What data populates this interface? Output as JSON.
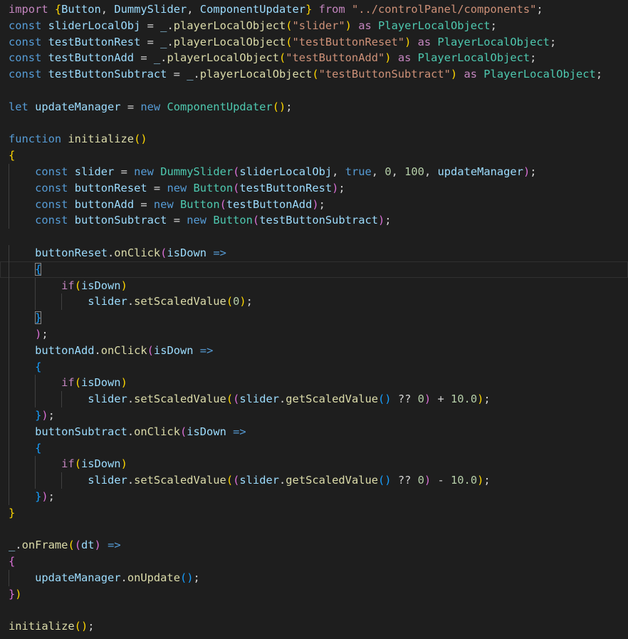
{
  "editor": {
    "language": "typescript",
    "theme": "dark",
    "lines": [
      [
        [
          "import ",
          "ctrl"
        ],
        [
          "{",
          "b1"
        ],
        [
          "Button",
          "var"
        ],
        [
          ", ",
          "op"
        ],
        [
          "DummySlider",
          "var"
        ],
        [
          ", ",
          "op"
        ],
        [
          "ComponentUpdater",
          "var"
        ],
        [
          "}",
          "b1"
        ],
        [
          " from ",
          "ctrl"
        ],
        [
          "\"../controlPanel/components\"",
          "str"
        ],
        [
          ";",
          "op"
        ]
      ],
      [
        [
          "const ",
          "kw"
        ],
        [
          "sliderLocalObj",
          "var"
        ],
        [
          " = ",
          "op"
        ],
        [
          "_",
          "var"
        ],
        [
          ".",
          "op"
        ],
        [
          "playerLocalObject",
          "fn"
        ],
        [
          "(",
          "b1"
        ],
        [
          "\"slider\"",
          "str"
        ],
        [
          ")",
          "b1"
        ],
        [
          " as ",
          "ctrl"
        ],
        [
          "PlayerLocalObject",
          "cls"
        ],
        [
          ";",
          "op"
        ]
      ],
      [
        [
          "const ",
          "kw"
        ],
        [
          "testButtonRest",
          "var"
        ],
        [
          " = ",
          "op"
        ],
        [
          "_",
          "var"
        ],
        [
          ".",
          "op"
        ],
        [
          "playerLocalObject",
          "fn"
        ],
        [
          "(",
          "b1"
        ],
        [
          "\"testButtonReset\"",
          "str"
        ],
        [
          ")",
          "b1"
        ],
        [
          " as ",
          "ctrl"
        ],
        [
          "PlayerLocalObject",
          "cls"
        ],
        [
          ";",
          "op"
        ]
      ],
      [
        [
          "const ",
          "kw"
        ],
        [
          "testButtonAdd",
          "var"
        ],
        [
          " = ",
          "op"
        ],
        [
          "_",
          "var"
        ],
        [
          ".",
          "op"
        ],
        [
          "playerLocalObject",
          "fn"
        ],
        [
          "(",
          "b1"
        ],
        [
          "\"testButtonAdd\"",
          "str"
        ],
        [
          ")",
          "b1"
        ],
        [
          " as ",
          "ctrl"
        ],
        [
          "PlayerLocalObject",
          "cls"
        ],
        [
          ";",
          "op"
        ]
      ],
      [
        [
          "const ",
          "kw"
        ],
        [
          "testButtonSubtract",
          "var"
        ],
        [
          " = ",
          "op"
        ],
        [
          "_",
          "var"
        ],
        [
          ".",
          "op"
        ],
        [
          "playerLocalObject",
          "fn"
        ],
        [
          "(",
          "b1"
        ],
        [
          "\"testButtonSubtract\"",
          "str"
        ],
        [
          ")",
          "b1"
        ],
        [
          " as ",
          "ctrl"
        ],
        [
          "PlayerLocalObject",
          "cls"
        ],
        [
          ";",
          "op"
        ]
      ],
      [],
      [
        [
          "let ",
          "kw"
        ],
        [
          "updateManager",
          "var"
        ],
        [
          " = ",
          "op"
        ],
        [
          "new ",
          "kw"
        ],
        [
          "ComponentUpdater",
          "cls"
        ],
        [
          "()",
          "b1"
        ],
        [
          ";",
          "op"
        ]
      ],
      [],
      [
        [
          "function ",
          "kw"
        ],
        [
          "initialize",
          "fn"
        ],
        [
          "()",
          "b1"
        ]
      ],
      [
        [
          "{",
          "b1"
        ]
      ],
      [
        [
          "    ",
          "op"
        ],
        [
          "const ",
          "kw"
        ],
        [
          "slider",
          "var"
        ],
        [
          " = ",
          "op"
        ],
        [
          "new ",
          "kw"
        ],
        [
          "DummySlider",
          "cls"
        ],
        [
          "(",
          "b2"
        ],
        [
          "sliderLocalObj",
          "var"
        ],
        [
          ", ",
          "op"
        ],
        [
          "true",
          "kw"
        ],
        [
          ", ",
          "op"
        ],
        [
          "0",
          "num"
        ],
        [
          ", ",
          "op"
        ],
        [
          "100",
          "num"
        ],
        [
          ", ",
          "op"
        ],
        [
          "updateManager",
          "var"
        ],
        [
          ")",
          "b2"
        ],
        [
          ";",
          "op"
        ]
      ],
      [
        [
          "    ",
          "op"
        ],
        [
          "const ",
          "kw"
        ],
        [
          "buttonReset",
          "var"
        ],
        [
          " = ",
          "op"
        ],
        [
          "new ",
          "kw"
        ],
        [
          "Button",
          "cls"
        ],
        [
          "(",
          "b2"
        ],
        [
          "testButtonRest",
          "var"
        ],
        [
          ")",
          "b2"
        ],
        [
          ";",
          "op"
        ]
      ],
      [
        [
          "    ",
          "op"
        ],
        [
          "const ",
          "kw"
        ],
        [
          "buttonAdd",
          "var"
        ],
        [
          " = ",
          "op"
        ],
        [
          "new ",
          "kw"
        ],
        [
          "Button",
          "cls"
        ],
        [
          "(",
          "b2"
        ],
        [
          "testButtonAdd",
          "var"
        ],
        [
          ")",
          "b2"
        ],
        [
          ";",
          "op"
        ]
      ],
      [
        [
          "    ",
          "op"
        ],
        [
          "const ",
          "kw"
        ],
        [
          "buttonSubtract",
          "var"
        ],
        [
          " = ",
          "op"
        ],
        [
          "new ",
          "kw"
        ],
        [
          "Button",
          "cls"
        ],
        [
          "(",
          "b2"
        ],
        [
          "testButtonSubtract",
          "var"
        ],
        [
          ")",
          "b2"
        ],
        [
          ";",
          "op"
        ]
      ],
      [],
      [
        [
          "    ",
          "op"
        ],
        [
          "buttonReset",
          "var"
        ],
        [
          ".",
          "op"
        ],
        [
          "onClick",
          "fn"
        ],
        [
          "(",
          "b2"
        ],
        [
          "isDown",
          "var"
        ],
        [
          " =>",
          "kw"
        ]
      ],
      [
        [
          "    ",
          "op"
        ],
        [
          "{",
          "b3 bm"
        ]
      ],
      [
        [
          "        ",
          "op"
        ],
        [
          "if",
          "ctrl"
        ],
        [
          "(",
          "b1"
        ],
        [
          "isDown",
          "var"
        ],
        [
          ")",
          "b1"
        ]
      ],
      [
        [
          "            ",
          "op"
        ],
        [
          "slider",
          "var"
        ],
        [
          ".",
          "op"
        ],
        [
          "setScaledValue",
          "fn"
        ],
        [
          "(",
          "b1"
        ],
        [
          "0",
          "num"
        ],
        [
          ")",
          "b1"
        ],
        [
          ";",
          "op"
        ]
      ],
      [
        [
          "    ",
          "op"
        ],
        [
          "}",
          "b3 bm"
        ]
      ],
      [
        [
          "    ",
          "op"
        ],
        [
          ")",
          "b2"
        ],
        [
          ";",
          "op"
        ]
      ],
      [
        [
          "    ",
          "op"
        ],
        [
          "buttonAdd",
          "var"
        ],
        [
          ".",
          "op"
        ],
        [
          "onClick",
          "fn"
        ],
        [
          "(",
          "b2"
        ],
        [
          "isDown",
          "var"
        ],
        [
          " =>",
          "kw"
        ]
      ],
      [
        [
          "    ",
          "op"
        ],
        [
          "{",
          "b3"
        ]
      ],
      [
        [
          "        ",
          "op"
        ],
        [
          "if",
          "ctrl"
        ],
        [
          "(",
          "b1"
        ],
        [
          "isDown",
          "var"
        ],
        [
          ")",
          "b1"
        ]
      ],
      [
        [
          "            ",
          "op"
        ],
        [
          "slider",
          "var"
        ],
        [
          ".",
          "op"
        ],
        [
          "setScaledValue",
          "fn"
        ],
        [
          "(",
          "b1"
        ],
        [
          "(",
          "b2"
        ],
        [
          "slider",
          "var"
        ],
        [
          ".",
          "op"
        ],
        [
          "getScaledValue",
          "fn"
        ],
        [
          "()",
          "b3"
        ],
        [
          " ?? ",
          "op"
        ],
        [
          "0",
          "num"
        ],
        [
          ")",
          "b2"
        ],
        [
          " + ",
          "op"
        ],
        [
          "10.0",
          "num"
        ],
        [
          ")",
          "b1"
        ],
        [
          ";",
          "op"
        ]
      ],
      [
        [
          "    ",
          "op"
        ],
        [
          "}",
          "b3"
        ],
        [
          ")",
          "b2"
        ],
        [
          ";",
          "op"
        ]
      ],
      [
        [
          "    ",
          "op"
        ],
        [
          "buttonSubtract",
          "var"
        ],
        [
          ".",
          "op"
        ],
        [
          "onClick",
          "fn"
        ],
        [
          "(",
          "b2"
        ],
        [
          "isDown",
          "var"
        ],
        [
          " =>",
          "kw"
        ]
      ],
      [
        [
          "    ",
          "op"
        ],
        [
          "{",
          "b3"
        ]
      ],
      [
        [
          "        ",
          "op"
        ],
        [
          "if",
          "ctrl"
        ],
        [
          "(",
          "b1"
        ],
        [
          "isDown",
          "var"
        ],
        [
          ")",
          "b1"
        ]
      ],
      [
        [
          "            ",
          "op"
        ],
        [
          "slider",
          "var"
        ],
        [
          ".",
          "op"
        ],
        [
          "setScaledValue",
          "fn"
        ],
        [
          "(",
          "b1"
        ],
        [
          "(",
          "b2"
        ],
        [
          "slider",
          "var"
        ],
        [
          ".",
          "op"
        ],
        [
          "getScaledValue",
          "fn"
        ],
        [
          "()",
          "b3"
        ],
        [
          " ?? ",
          "op"
        ],
        [
          "0",
          "num"
        ],
        [
          ")",
          "b2"
        ],
        [
          " - ",
          "op"
        ],
        [
          "10.0",
          "num"
        ],
        [
          ")",
          "b1"
        ],
        [
          ";",
          "op"
        ]
      ],
      [
        [
          "    ",
          "op"
        ],
        [
          "}",
          "b3"
        ],
        [
          ")",
          "b2"
        ],
        [
          ";",
          "op"
        ]
      ],
      [
        [
          "}",
          "b1"
        ]
      ],
      [],
      [
        [
          "_",
          "var"
        ],
        [
          ".",
          "op"
        ],
        [
          "onFrame",
          "fn"
        ],
        [
          "(",
          "b1"
        ],
        [
          "(",
          "b2"
        ],
        [
          "dt",
          "var"
        ],
        [
          ")",
          "b2"
        ],
        [
          " =>",
          "kw"
        ]
      ],
      [
        [
          "{",
          "b2"
        ]
      ],
      [
        [
          "    ",
          "op"
        ],
        [
          "updateManager",
          "var"
        ],
        [
          ".",
          "op"
        ],
        [
          "onUpdate",
          "fn"
        ],
        [
          "()",
          "b3"
        ],
        [
          ";",
          "op"
        ]
      ],
      [
        [
          "}",
          "b2"
        ],
        [
          ")",
          "b1"
        ]
      ],
      [],
      [
        [
          "initialize",
          "fn"
        ],
        [
          "()",
          "b1"
        ],
        [
          ";",
          "op"
        ]
      ]
    ]
  }
}
